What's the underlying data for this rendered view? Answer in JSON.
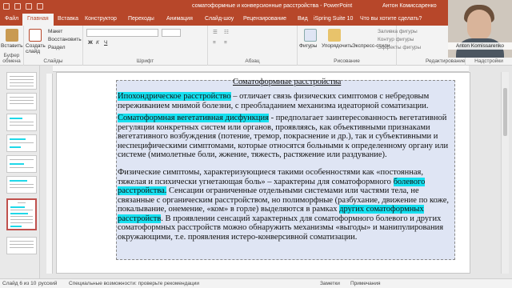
{
  "window": {
    "title": "соматоформные и конверсионные расстройства  -  PowerPoint",
    "user": "Антон Комиссаренко"
  },
  "tabs": [
    "Файл",
    "Главная",
    "Вставка",
    "Конструктор",
    "Переходы",
    "Анимация",
    "Слайд-шоу",
    "Рецензирование",
    "Вид",
    "iSpring Suite 10"
  ],
  "tell_me": "Что вы хотите сделать?",
  "ribbon": {
    "paste_label": "Вставить",
    "new_slide_label": "Создать слайд",
    "layout_label": "Макет",
    "reset_label": "Восстановить",
    "section_label": "Раздел",
    "clipboard_group": "Буфер обмена",
    "slides_group": "Слайды",
    "font_group": "Шрифт",
    "paragraph_group": "Абзац",
    "shapes_label": "Фигуры",
    "arrange_label": "Упорядочить",
    "quick_styles_label": "Экспресс-стили",
    "fill_label": "Заливка фигуры",
    "outline_label": "Контур фигуры",
    "effects_label": "Эффекты фигуры",
    "drawing_group": "Рисование",
    "editing_group": "Редактирование",
    "designer_group": "Надстройки"
  },
  "webcam": {
    "name": "Anton Komissarenko"
  },
  "slide": {
    "title": "Соматоформные расстройства",
    "p1_hl": "Ипохондрическое расстройство",
    "p1_rest": " – отличает связь физических симптомов с небредовым переживанием мнимой болезни, с преобладанием механизма идеаторной соматизации.",
    "p2_hl": "Соматоформная вегетативная дисфункция",
    "p2_rest": " - предполагает заинтересованность вегетативной регуляции конкретных систем или органов, проявляясь, как объективными признаками вегетативного возбуждения (потение, тремор, покраснение и др.), так и субъективными и неспецифическими симптомами, которые относятся больными к определенному органу или системе (мимолетные боли, жжение, тяжесть, растяжение или раздувание).",
    "p3_a": "Физические симптомы, характеризующиеся такими особенностями как «постоянная, тяжелая и психически угнетающая боль» – характерны для соматоформного ",
    "p3_hl1": "болевого расстройства.",
    "p3_b": " Сенсации ограниченные отдельными системами или частями тела, не связанные с органическим расстройством, но полиморфные (разбухание, движение по коже, покалывание, онемение, «ком» в горле) выделяются в рамках ",
    "p3_hl2": "других соматоформных расстройств",
    "p3_c": ". В проявлении сенсаций характерных для соматоформного болевого и других соматоформных расстройств можно обнаружить механизмы «выгоды» и манипулирования окружающими, т.е. проявления истеро-конверсивной соматизации."
  },
  "status": {
    "slide_counter": "Слайд 6 из 10",
    "language": "русский",
    "accessibility": "Специальные возможности: проверьте рекомендации",
    "notes": "Заметки",
    "comments": "Примечания"
  },
  "colors": {
    "accent": "#b7472a",
    "highlight": "#16e0f0",
    "textbox_bg": "#dfe5f4"
  }
}
